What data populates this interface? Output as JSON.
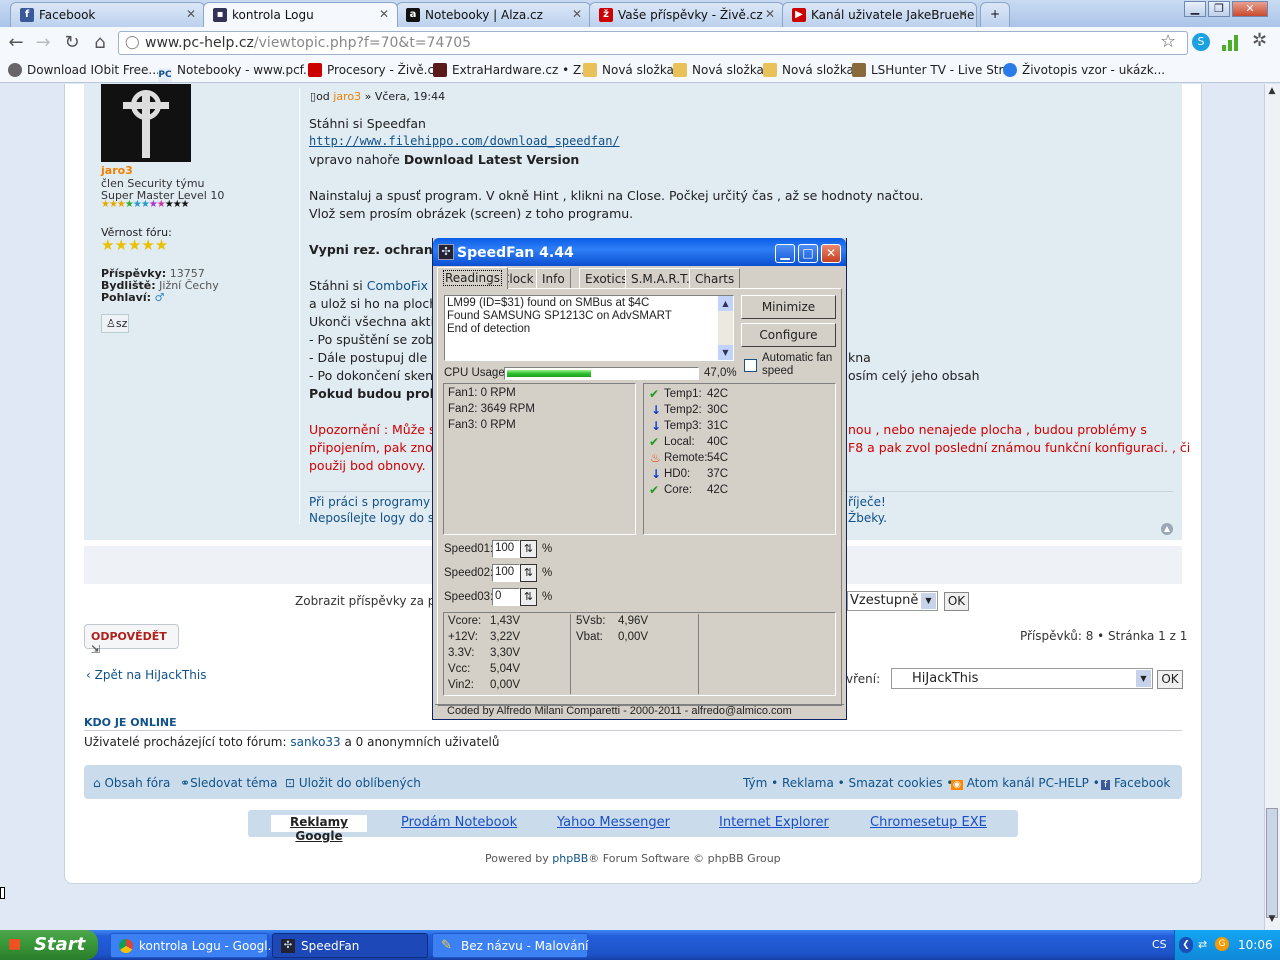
{
  "browser": {
    "tabs": [
      {
        "title": "Facebook",
        "fav": "f",
        "color": "#3b5998"
      },
      {
        "title": "kontrola Logu",
        "fav": "■",
        "color": "#335"
      },
      {
        "title": "Notebooky | Alza.cz",
        "fav": "a",
        "color": "#111"
      },
      {
        "title": "Vaše příspěvky - Živě.cz",
        "fav": "ž",
        "color": "#c00"
      },
      {
        "title": "Kanál uživatele JakeBruene - Y",
        "fav": "▶",
        "color": "#c00"
      }
    ],
    "url_host": "www.pc-help.cz",
    "url_path": "/viewtopic.php?f=70&t=74705",
    "bookmarks": [
      "Download IObit Free...",
      "Notebooky - www.pcf...",
      "Procesory - Živě.cz",
      "ExtraHardware.cz • Z...",
      "Nová složka",
      "Nová složka",
      "Nová složka",
      "LSHunter TV - Live Str...",
      "Životopis vzor - ukázk..."
    ]
  },
  "post": {
    "author": "jaro3",
    "rank1": "člen Security týmu",
    "rank2": "Super Master Level 10",
    "loyalty_label": "Věrnost fóru:",
    "posts_label": "Příspěvky:",
    "posts_value": "13757",
    "residence_label": "Bydliště:",
    "residence_value": "Jižní Čechy",
    "gender_label": "Pohlaví:",
    "pm_label": "sz",
    "meta_prefix": "od",
    "meta_author": "jaro3",
    "meta_date": "» Včera, 19:44",
    "l1": "Stáhni si Speedfan",
    "l2": "http://www.filehippo.com/download_speedfan/",
    "l3a": "vpravo nahoře ",
    "l3b": "Download Latest Version",
    "l4": "Nainstaluj a spusť program. V okně Hint , klikni na Close. Počkej určitý čas , až se hodnoty načtou.",
    "l5": "Vlož sem prosím obrázek (screen) z toho programu.",
    "l6": "Vypni rez. ochranu",
    "l7a": "Stáhni si ",
    "l7b": "ComboFix (",
    "l8": "a ulož si ho na plochu",
    "l9": "Ukonči všechna aktiv",
    "l10": "- Po spuštění se zobr",
    "l11": "- Dále postupuj dle pc",
    "l11b": "kna",
    "l12": "- Po dokončení skeno",
    "l12b": "osím celý jeho obsah",
    "l13": "Pokud budou proble",
    "warn1a": "Upozornění : Může se",
    "warn1b": "nou , nebo nenajede plocha , budou problémy s",
    "warn2a": "připojením, pak znov",
    "warn2b": "F8 a pak zvol poslední známou funkční konfiguraci. , či",
    "warn3": "použij bod obnovy.",
    "sig1a": "Při práci s programy I",
    "sig1b": "říječe!",
    "sig2a": "Neposílejte logy do so",
    "sig2b": "Žbeky."
  },
  "forum": {
    "show_posts": "Zobrazit příspěvky za pr",
    "sort_dir": "Vzestupně",
    "ok": "OK",
    "reply": "ODPOVĚDĚT",
    "count": "Příspěvků: 8 • Stránka 1 z 1",
    "back": "Zpět na HiJackThis",
    "jump_label": "vření:",
    "jump_value": "HiJackThis",
    "online_title": "KDO JE ONLINE",
    "online_text": "Uživatelé procházející toto fórum: ",
    "online_user": "sanko33",
    "online_rest": " a 0 anonymních uživatelů",
    "footer_left": [
      "Obsah fóra",
      "Sledovat téma",
      "Uložit do oblíbených"
    ],
    "footer_right": "Tým • Reklama • Smazat cookies •",
    "footer_atom": "Atom kanál PC-HELP •",
    "footer_fb": "Facebook",
    "ads": [
      "Reklamy Google",
      "Prodám Notebook",
      "Yahoo Messenger",
      "Internet Explorer",
      "Chromesetup EXE"
    ],
    "powered": "Powered by",
    "phpbb": "phpBB",
    "powered_rest": "® Forum Software © phpBB Group"
  },
  "speedfan": {
    "title": "SpeedFan 4.44",
    "tabs": [
      "Readings",
      "Clock",
      "Info",
      "Exotics",
      "S.M.A.R.T.",
      "Charts"
    ],
    "log": [
      "LM99 (ID=$31) found on SMBus at $4C",
      "Found SAMSUNG SP1213C on AdvSMART",
      "End of detection"
    ],
    "minimize": "Minimize",
    "configure": "Configure",
    "auto_fan": "Automatic fan speed",
    "cpu_label": "CPU Usage",
    "cpu_value": "47,0%",
    "cpu_fraction": 0.47,
    "fans": [
      "Fan1: 0 RPM",
      "Fan2: 3649 RPM",
      "Fan3: 0 RPM"
    ],
    "temps": [
      {
        "name": "Temp1:",
        "value": "42C",
        "icon": "check-icon"
      },
      {
        "name": "Temp2:",
        "value": "30C",
        "icon": "arrow-down-icon"
      },
      {
        "name": "Temp3:",
        "value": "31C",
        "icon": "arrow-down-icon"
      },
      {
        "name": "Local:",
        "value": "40C",
        "icon": "check-icon"
      },
      {
        "name": "Remote:",
        "value": "54C",
        "icon": "flame-icon"
      },
      {
        "name": "HD0:",
        "value": "37C",
        "icon": "arrow-down-icon"
      },
      {
        "name": "Core:",
        "value": "42C",
        "icon": "check-icon"
      }
    ],
    "speeds": [
      {
        "label": "Speed01:",
        "value": "100"
      },
      {
        "label": "Speed02:",
        "value": "100"
      },
      {
        "label": "Speed03:",
        "value": "0"
      }
    ],
    "pct": "%",
    "volts_a": [
      [
        "Vcore:",
        "1,43V"
      ],
      [
        "+12V:",
        "3,22V"
      ],
      [
        "3.3V:",
        "3,30V"
      ],
      [
        "Vcc:",
        "5,04V"
      ],
      [
        "Vin2:",
        "0,00V"
      ]
    ],
    "volts_b": [
      [
        "5Vsb:",
        "4,96V"
      ],
      [
        "Vbat:",
        "0,00V"
      ]
    ],
    "credit": "Coded by Alfredo Milani Comparetti - 2000-2011 - alfredo@almico.com"
  },
  "taskbar": {
    "start": "Start",
    "items": [
      "kontrola Logu - Googl...",
      "SpeedFan",
      "Bez názvu - Malování"
    ],
    "lang": "CS",
    "clock": "10:06"
  }
}
